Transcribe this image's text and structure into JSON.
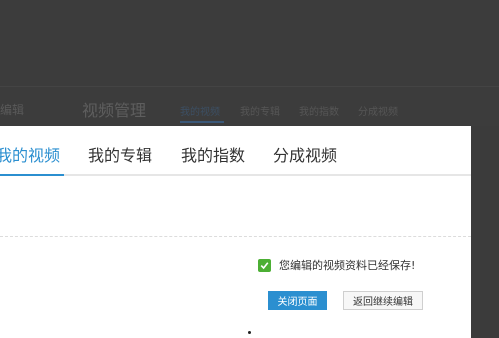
{
  "background_page": {
    "left_text": "编辑",
    "title": "视频管理",
    "tabs": [
      "我的视频",
      "我的专辑",
      "我的指数",
      "分成视频"
    ]
  },
  "modal": {
    "tabs": [
      {
        "label": "我的视频",
        "active": true
      },
      {
        "label": "我的专辑",
        "active": false
      },
      {
        "label": "我的指数",
        "active": false
      },
      {
        "label": "分成视频",
        "active": false
      }
    ],
    "saved_message": "您编辑的视频资料已经保存!",
    "close_button": "关闭页面",
    "continue_button": "返回继续编辑"
  },
  "colors": {
    "accent": "#2b8fd0",
    "success": "#4caf34",
    "overlay": "#3c3c3c"
  }
}
